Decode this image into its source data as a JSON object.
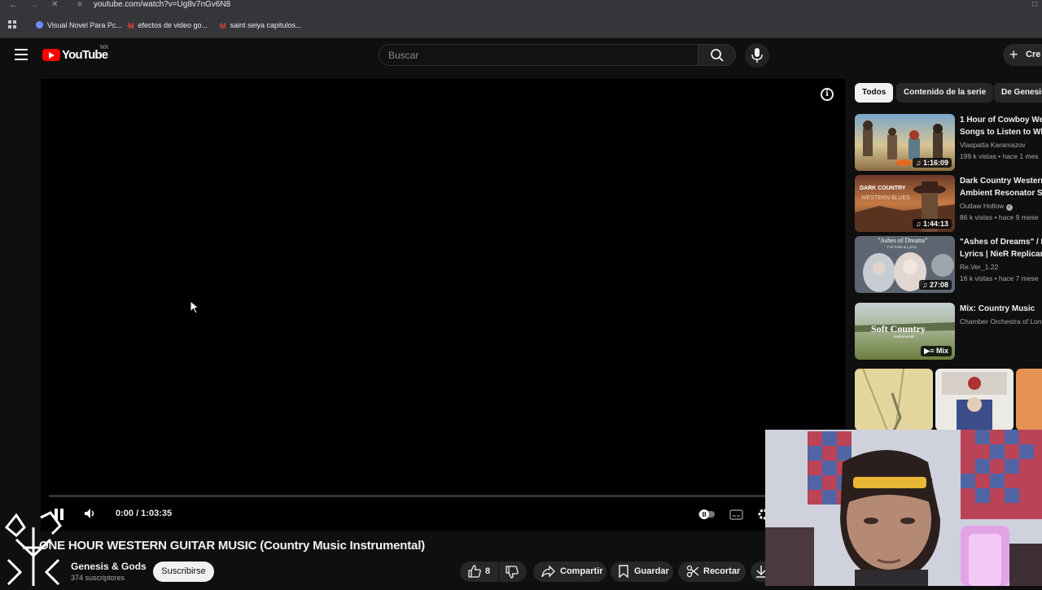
{
  "browser": {
    "url": "youtube.com/watch?v=Ug8v7nGv6N8",
    "bookmarks": [
      {
        "label": "Visual Novel Para Pc..."
      },
      {
        "label": "efectos de video go..."
      },
      {
        "label": "saint seiya capitulos..."
      }
    ]
  },
  "header": {
    "logo_text": "YouTube",
    "region": "MX",
    "search_placeholder": "Buscar",
    "create_label": "Cre"
  },
  "player": {
    "time": "0:00 / 1:03:35",
    "info_glyph": "i",
    "progress": 0
  },
  "video": {
    "title": "ONE HOUR WESTERN GUITAR MUSIC (Country Music Instrumental)",
    "channel": "Genesis & Gods",
    "subscribers": "374 suscriptores",
    "subscribe_label": "Suscribirse",
    "likes": "8",
    "share_label": "Compartir",
    "save_label": "Guardar",
    "clip_label": "Recortar"
  },
  "sidebar": {
    "chips": [
      "Todos",
      "Contenido de la serie",
      "De Genesis"
    ],
    "items": [
      {
        "title1": "1 Hour of Cowboy We",
        "title2": "Songs to Listen to Wh",
        "channel": "Vlaspatta Karamazov",
        "meta": "199 k vistas • hace 1 mes",
        "duration": "1:16:09"
      },
      {
        "title1": "Dark Country Western",
        "title2": "Ambient Resonator Sl",
        "channel": "Outlaw Hollow",
        "meta": "86 k vistas • hace 9 mese",
        "duration": "1:44:13",
        "thumb_text1": "DARK COUNTRY",
        "thumb_text2": "WESTERN BLUES"
      },
      {
        "title1": "\"Ashes of Dreams\" / F",
        "title2": "Lyrics | NieR Replican",
        "channel": "Re.Ver_1.22",
        "meta": "16 k vistas • hace 7 mese",
        "duration": "27:08",
        "thumb_text1": "\"Ashes of Dreams\"",
        "thumb_text2": "Full Suite & Lyrics"
      },
      {
        "title1": "Mix: Country Music",
        "channel": "Chamber Orchestra of Lon",
        "duration": "Mix",
        "thumb_text1": "Soft Country",
        "thumb_text2": "instrumental"
      }
    ]
  }
}
